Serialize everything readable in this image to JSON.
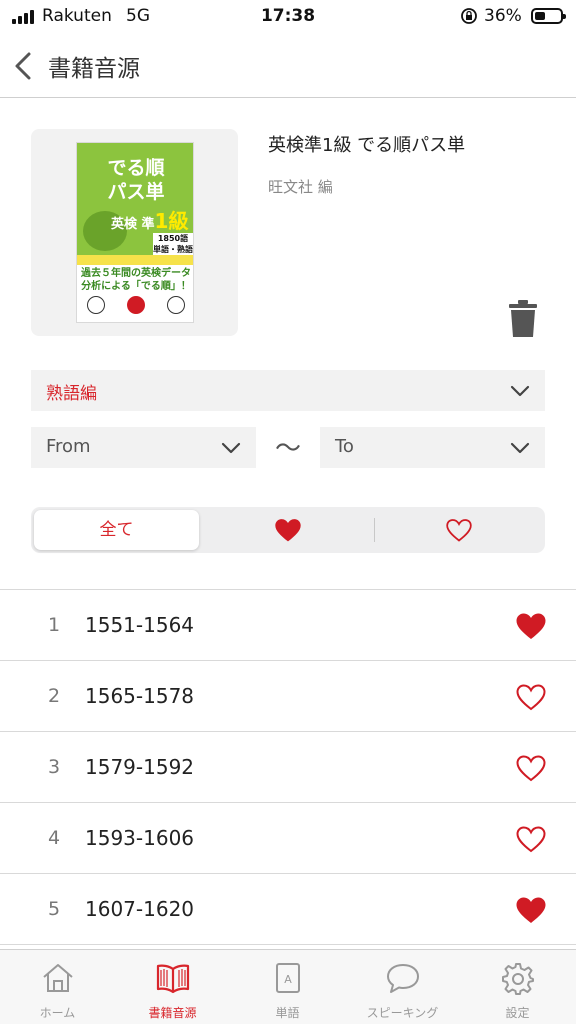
{
  "status_bar": {
    "carrier": "Rakuten",
    "network": "5G",
    "time": "17:38",
    "battery_percent": "36%"
  },
  "nav": {
    "title": "書籍音源",
    "back_icon": "chevron-left-icon"
  },
  "book": {
    "title": "英検準1級 でる順パス単",
    "publisher": "旺文社 編",
    "cover": {
      "line1": "でる順",
      "line2": "パス単",
      "grade_prefix": "英検 準",
      "grade_number": "1級",
      "word_count_line1": "1850語",
      "word_count_line2": "単語・熟語",
      "tagline_line1": "過去５年間の英検データ",
      "tagline_line2": "分析による「でる順」！"
    },
    "delete_icon": "trash-icon"
  },
  "filters": {
    "section_value": "熟語編",
    "from_value": "From",
    "to_value": "To",
    "range_separator": "〜"
  },
  "segments": {
    "all_label": "全て",
    "favorites_icon": "heart-filled-icon",
    "non_favorites_icon": "heart-outline-icon",
    "selected": "all"
  },
  "list": {
    "items": [
      {
        "index": "1",
        "range": "1551-1564",
        "favorite": true
      },
      {
        "index": "2",
        "range": "1565-1578",
        "favorite": false
      },
      {
        "index": "3",
        "range": "1579-1592",
        "favorite": false
      },
      {
        "index": "4",
        "range": "1593-1606",
        "favorite": false
      },
      {
        "index": "5",
        "range": "1607-1620",
        "favorite": true
      }
    ]
  },
  "tab_bar": {
    "tabs": [
      {
        "label": "ホーム",
        "icon": "home-icon",
        "active": false
      },
      {
        "label": "書籍音源",
        "icon": "book-icon",
        "active": true
      },
      {
        "label": "単語",
        "icon": "word-card-icon",
        "active": false
      },
      {
        "label": "スピーキング",
        "icon": "speech-bubble-icon",
        "active": false
      },
      {
        "label": "設定",
        "icon": "gear-icon",
        "active": false
      }
    ]
  },
  "colors": {
    "accent": "#d8262c",
    "heart": "#d01b24",
    "field_background": "#f2f2f2"
  }
}
